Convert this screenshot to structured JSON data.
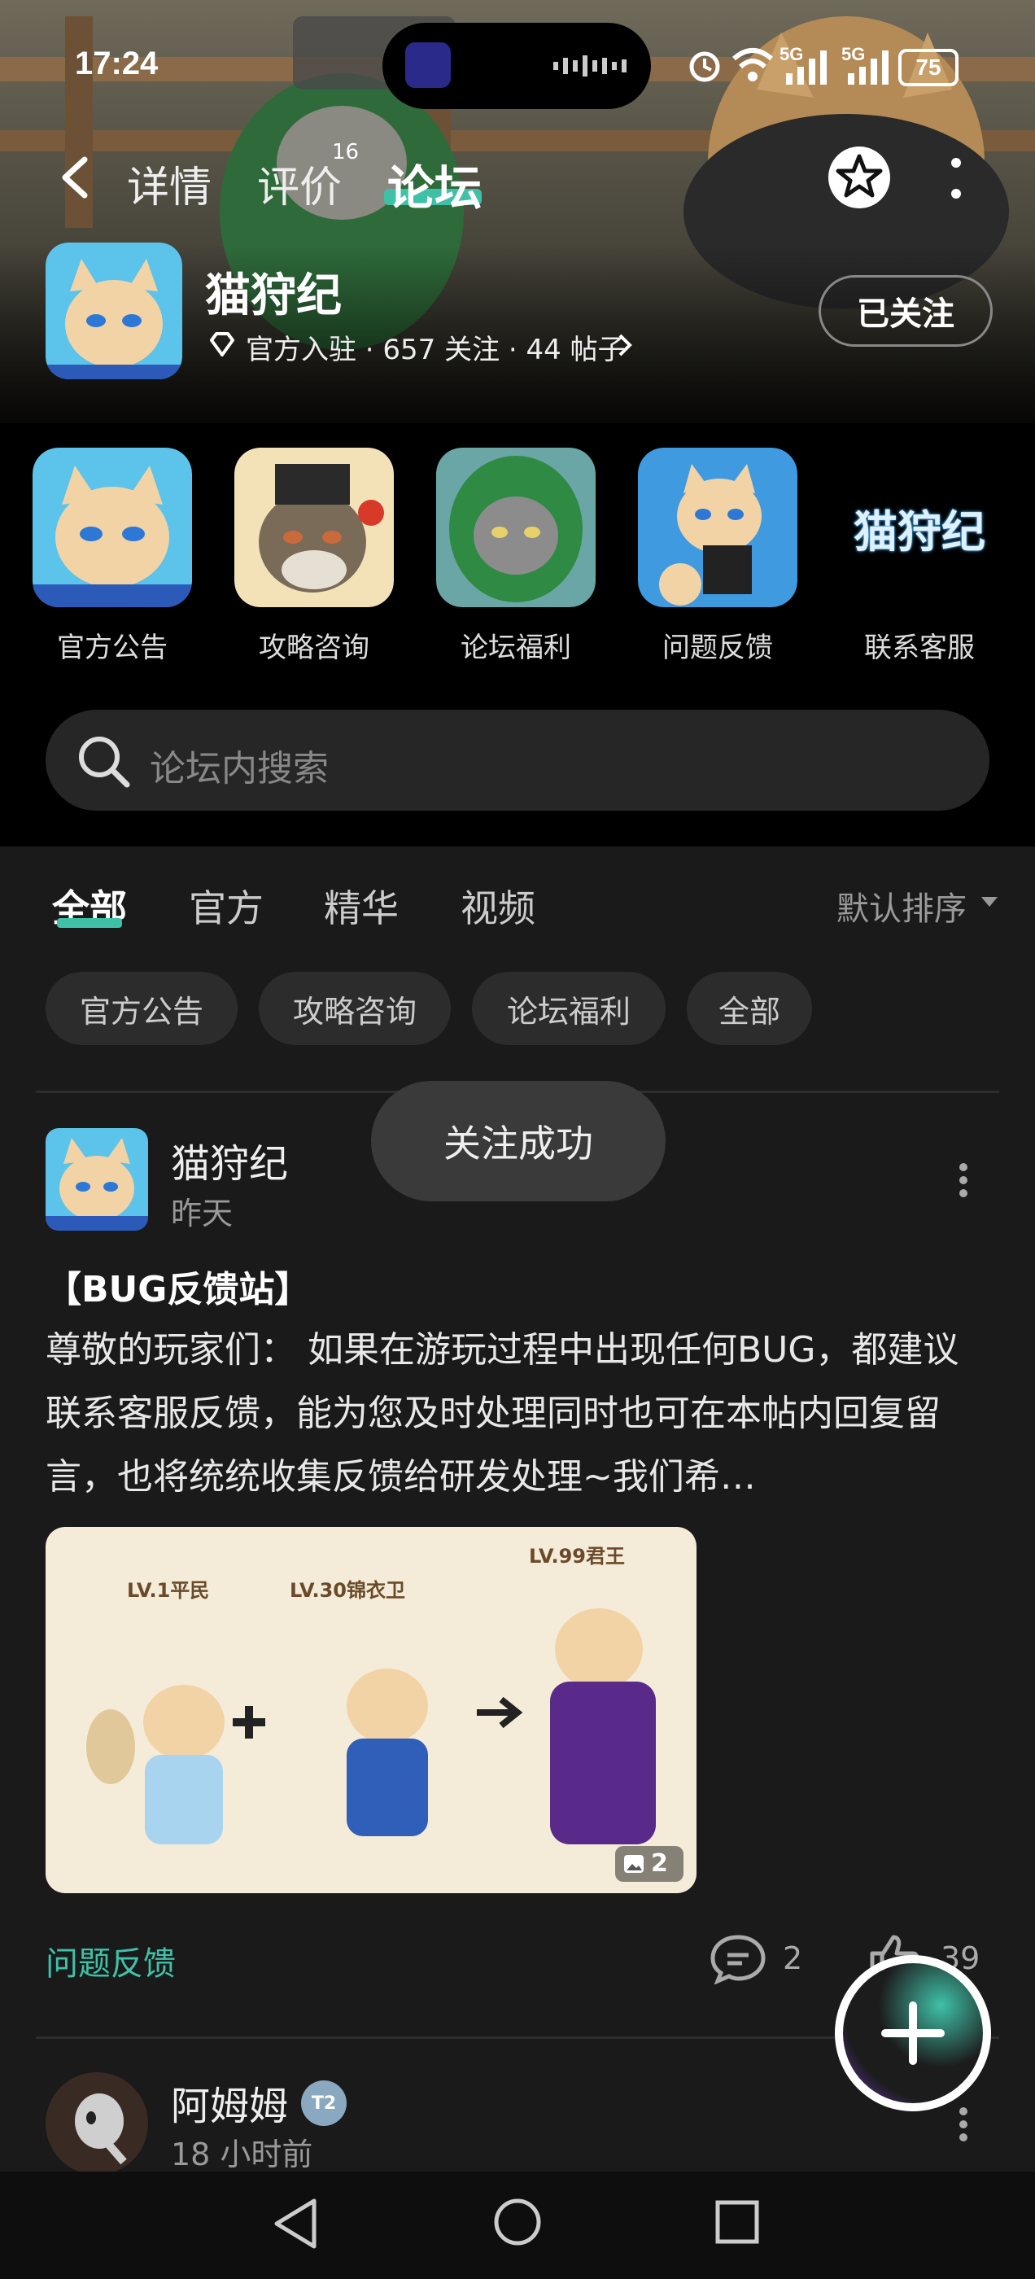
{
  "status_bar": {
    "time": "17:24",
    "network": "5G",
    "network2": "5G",
    "battery": "75"
  },
  "nav": {
    "tabs": [
      {
        "label": "详情"
      },
      {
        "label": "评价",
        "badge": "16"
      },
      {
        "label": "论坛"
      }
    ]
  },
  "game": {
    "name": "猫狩纪",
    "meta": "官方入驻 · 657 关注 · 44 帖子",
    "follow_label": "已关注"
  },
  "shortcuts": [
    {
      "label": "官方公告"
    },
    {
      "label": "攻略咨询"
    },
    {
      "label": "论坛福利"
    },
    {
      "label": "问题反馈"
    },
    {
      "label": "联系客服",
      "logo_text": "猫狩纪"
    }
  ],
  "search": {
    "placeholder": "论坛内搜索"
  },
  "feed_tabs": [
    {
      "label": "全部"
    },
    {
      "label": "官方"
    },
    {
      "label": "精华"
    },
    {
      "label": "视频"
    }
  ],
  "sort_label": "默认排序",
  "filter_chips": [
    {
      "label": "官方公告"
    },
    {
      "label": "攻略咨询"
    },
    {
      "label": "论坛福利"
    },
    {
      "label": "全部"
    }
  ],
  "toast": "关注成功",
  "post1": {
    "author": "猫狩纪",
    "time": "昨天",
    "title": "【BUG反馈站】",
    "body": "尊敬的玩家们：  如果在游玩过程中出现任何BUG，都建议联系客服反馈，能为您及时处理同时也可在本帖内回复留言，也将统统收集反馈给研发处理~我们希…",
    "image_labels": {
      "a": "LV.1平民",
      "b": "LV.30锦衣卫",
      "c": "LV.99君王"
    },
    "image_count": "2",
    "tag": "问题反馈",
    "comments": "2",
    "likes": "39"
  },
  "post2": {
    "author": "阿姆姆",
    "badge": "T2",
    "time": "18 小时前"
  },
  "colors": {
    "accent": "#3fc1a8",
    "background": "#1a1a1a"
  }
}
